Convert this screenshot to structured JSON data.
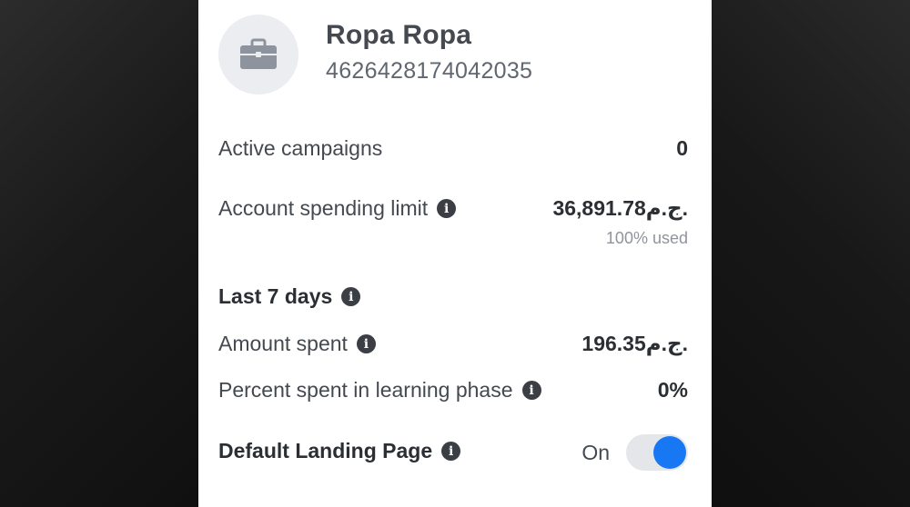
{
  "account": {
    "name": "Ropa Ropa",
    "id": "4626428174042035",
    "avatar_icon": "briefcase-icon"
  },
  "stats": {
    "active_campaigns_label": "Active campaigns",
    "active_campaigns_value": "0",
    "spending_limit_label": "Account spending limit",
    "spending_limit_value": "36,891.78ج.م.",
    "spending_limit_used": "100% used"
  },
  "last_7_days": {
    "heading": "Last 7 days",
    "amount_spent_label": "Amount spent",
    "amount_spent_value": "196.35ج.م.",
    "learning_phase_label": "Percent spent in learning phase",
    "learning_phase_value": "0%"
  },
  "landing_page": {
    "label": "Default Landing Page",
    "toggle_state_label": "On",
    "enabled": true
  },
  "colors": {
    "toggle_on": "#1877f2",
    "icon": "#3b3f45"
  }
}
